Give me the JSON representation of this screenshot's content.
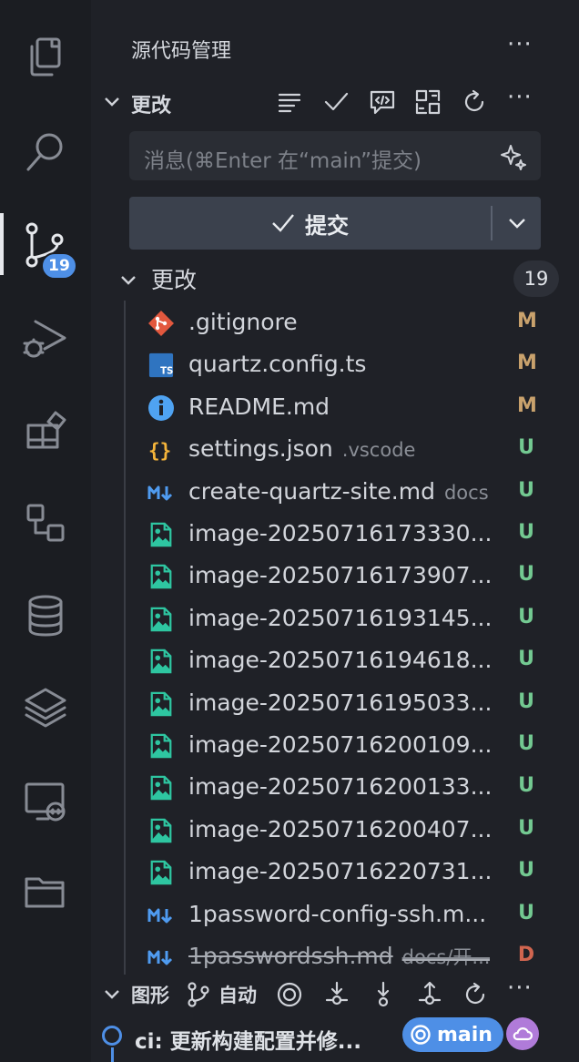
{
  "activity_bar": {
    "items": [
      {
        "icon": "explorer-icon",
        "active": false
      },
      {
        "icon": "search-icon",
        "active": false
      },
      {
        "icon": "source-control-icon",
        "active": true,
        "badge": "19"
      },
      {
        "icon": "run-debug-icon",
        "active": false
      },
      {
        "icon": "extensions-icon",
        "active": false
      },
      {
        "icon": "remote-explorer-icon",
        "active": false
      },
      {
        "icon": "database-icon",
        "active": false
      },
      {
        "icon": "layers-icon",
        "active": false
      },
      {
        "icon": "remote-window-icon",
        "active": false
      },
      {
        "icon": "folder-icon",
        "active": false
      }
    ],
    "badge": "19"
  },
  "header": {
    "title": "源代码管理",
    "more": "···"
  },
  "changes_section": {
    "label": "更改",
    "toolbar": [
      "view-as-list-icon",
      "commit-check-icon",
      "code-review-icon",
      "stage-all-icon",
      "refresh-icon",
      "more-icon"
    ],
    "more": "···"
  },
  "message_input": {
    "placeholder": "消息(⌘Enter 在“main”提交)"
  },
  "commit_button": {
    "label": "提交"
  },
  "changes_group": {
    "label": "更改",
    "count": "19"
  },
  "files": [
    {
      "name": ".gitignore",
      "dir": "",
      "status": "M",
      "icon": "git-icon"
    },
    {
      "name": "quartz.config.ts",
      "dir": "",
      "status": "M",
      "icon": "typescript-icon"
    },
    {
      "name": "README.md",
      "dir": "",
      "status": "M",
      "icon": "info-icon"
    },
    {
      "name": "settings.json",
      "dir": ".vscode",
      "status": "U",
      "icon": "json-icon"
    },
    {
      "name": "create-quartz-site.md",
      "dir": "docs",
      "status": "U",
      "icon": "markdown-icon"
    },
    {
      "name": "image-20250716173330...",
      "dir": "",
      "status": "U",
      "icon": "image-icon"
    },
    {
      "name": "image-20250716173907...",
      "dir": "",
      "status": "U",
      "icon": "image-icon"
    },
    {
      "name": "image-20250716193145...",
      "dir": "",
      "status": "U",
      "icon": "image-icon"
    },
    {
      "name": "image-20250716194618...",
      "dir": "",
      "status": "U",
      "icon": "image-icon"
    },
    {
      "name": "image-20250716195033...",
      "dir": "",
      "status": "U",
      "icon": "image-icon"
    },
    {
      "name": "image-20250716200109...",
      "dir": "",
      "status": "U",
      "icon": "image-icon"
    },
    {
      "name": "image-20250716200133...",
      "dir": "",
      "status": "U",
      "icon": "image-icon"
    },
    {
      "name": "image-20250716200407...",
      "dir": "",
      "status": "U",
      "icon": "image-icon"
    },
    {
      "name": "image-20250716220731...",
      "dir": "",
      "status": "U",
      "icon": "image-icon"
    },
    {
      "name": "1password-config-ssh.m...",
      "dir": "",
      "status": "U",
      "icon": "markdown-icon"
    },
    {
      "name": "1passwordssh.md",
      "dir": "docs/开...",
      "status": "D",
      "icon": "markdown-icon",
      "deleted": true
    }
  ],
  "graph_section": {
    "label": "图形",
    "auto_label": "自动",
    "more": "···"
  },
  "last_commit": {
    "message": "ci: 更新构建配置并修...",
    "branch": "main"
  },
  "colors": {
    "modified": "#c9a26d",
    "untracked": "#73c991",
    "deleted": "#d0654f",
    "accent": "#4e8fe6",
    "remote": "#b07bd9"
  }
}
